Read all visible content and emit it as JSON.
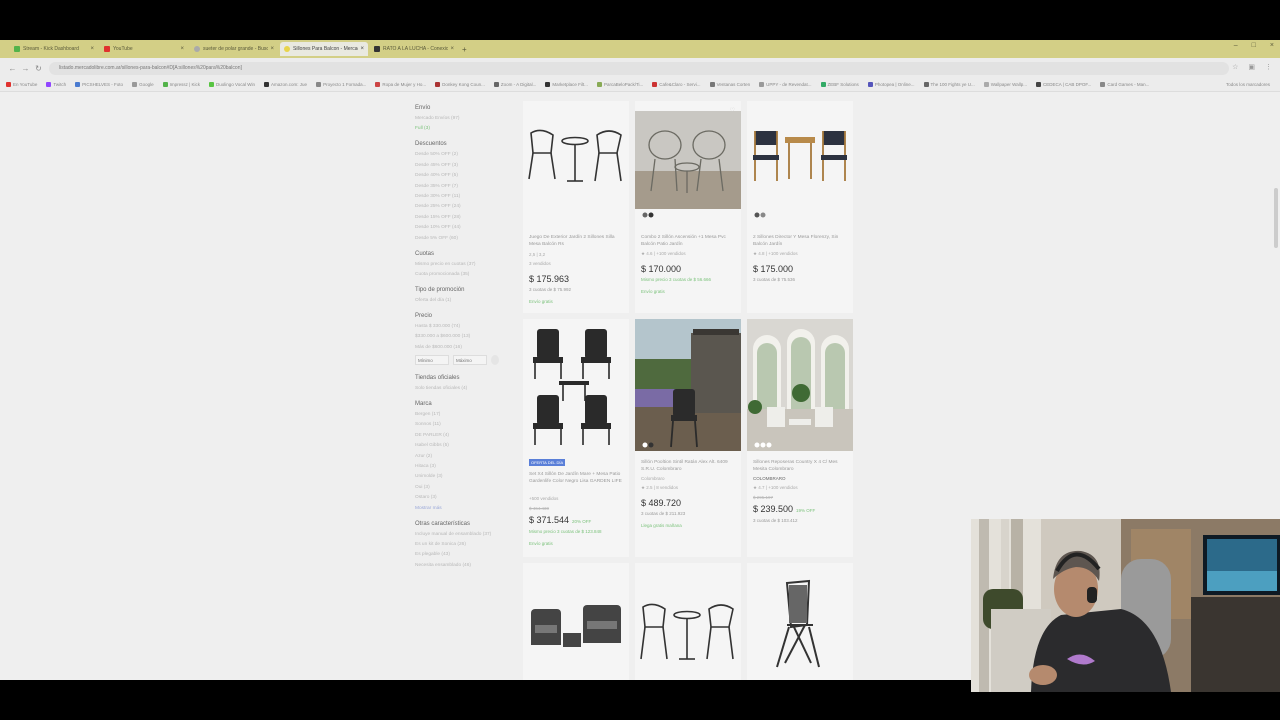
{
  "tabs": [
    {
      "title": "Stream - Kick Dashboard",
      "color": "#53b34a"
    },
    {
      "title": "YouTube",
      "color": "#e0322e"
    },
    {
      "title": "sueter de polar grande - Busc",
      "color": "#aaa"
    },
    {
      "title": "Sillones Para Balcon - Mercad",
      "color": "#aaa"
    },
    {
      "title": "RATO A LA LUCHA - Conexio",
      "color": "#333"
    }
  ],
  "url": "listado.mercadolibre.com.ar/sillones-para-balcon#D[A:sillones%20para%20balcon]",
  "bookmarks": [
    "En YouTube",
    "Twitch",
    "PICSHELVES - Foto",
    "Google",
    "Impressz | Kick",
    "Duolingo Vocal Win",
    "Amazon.com: Jue",
    "Proyecto 1 Fornada...",
    "Ropa de Mujer y Ho...",
    "Donkey Kong Coun...",
    "Zoom - A Digital...",
    "Marketplace Filt...",
    "ParcaBeloPack/Ti...",
    "Cafe&Claro - Servi...",
    "Ventanas Corten",
    "UPPY - de Revendat...",
    "ZEBF Solutions",
    "Photopea | Online...",
    "The 100 Fights ye U...",
    "Wallpaper Wallp...",
    "CEDECA | CAB DPOF...",
    "Card Games - Man..."
  ],
  "bookmarks_right": "Todos los marcadores",
  "sidebar": {
    "envio": {
      "title": "Envío",
      "items": [
        "Mercado Envíos (97)",
        "Full (3)"
      ]
    },
    "descuentos": {
      "title": "Descuentos",
      "items": [
        "Desde 50% OFF (2)",
        "Desde 45% OFF (3)",
        "Desde 40% OFF (5)",
        "Desde 35% OFF (7)",
        "Desde 30% OFF (11)",
        "Desde 25% OFF (24)",
        "Desde 15% OFF (28)",
        "Desde 10% OFF (44)",
        "Desde 5% OFF (60)"
      ]
    },
    "cuotas": {
      "title": "Cuotas",
      "items": [
        "Mismo precio en cuotas (37)",
        "Cuota promocionada (35)"
      ]
    },
    "promocion": {
      "title": "Tipo de promoción",
      "items": [
        "Oferta del día (1)"
      ]
    },
    "precio": {
      "title": "Precio",
      "items": [
        "Hasta $ 330.000 (74)",
        "$330.000 a $600.000 (13)",
        "Más de $600.000 (16)"
      ],
      "min": "Mínimo",
      "max": "Máximo"
    },
    "tiendas": {
      "title": "Tiendas oficiales",
      "items": [
        "Solo tiendas oficiales (4)"
      ]
    },
    "marca": {
      "title": "Marca",
      "items": [
        "Bergen (17)",
        "Sonnos (11)",
        "DE PARLER (4)",
        "Isabel Gibbs (5)",
        "Azur (2)",
        "Hitaca (3)",
        "Unimolde (3)",
        "Oui (3)",
        "Ostaro (3)"
      ],
      "more": "Mostrar más"
    },
    "otras": {
      "title": "Otras características",
      "items": [
        "Incluye manual de ensamblado (37)",
        "Es un kit de Sonica (26)",
        "Es plegable (43)",
        "Necesita ensamblado (46)"
      ]
    }
  },
  "products": [
    {
      "title": "Juego De Exterior Jardín 2 Sillones Silla Mesa Balcón Rs",
      "rating": "2,5 | 3,2",
      "sold": "3 vendidos",
      "price": "$ 175.963",
      "install": "3 cuotas de $ 75.992",
      "ship": "Envío gratis"
    },
    {
      "title": "Combo 2 Sillón Ascensión +1 Mesa Pvc Balcón Patio Jardín",
      "rating": "★ 4.6 | +100 vendidos",
      "price": "$ 170.000",
      "install": "Mismo precio 3 cuotas de $ 56.666",
      "ship": "Envío gratis"
    },
    {
      "title": "2 Sillones Director Y Mesa Florenzy, Sin Balcón Jardín",
      "rating": "★ 4.8 | +100 vendidos",
      "price": "$ 175.000",
      "install": "3 cuotas de $ 75.536"
    },
    {
      "badge": "OFERTA DEL DÍA",
      "title": "Set X4 Sillón De Jardín Mare + Mesa Patio Gardenlife Color Negro Lisa GARDEN LIFE",
      "sold": "+500 vendidos",
      "oldprice": "$ 464.430",
      "price": "$ 371.544",
      "off": "20% OFF",
      "install": "Mismo precio 3 cuotas de $ 123.848",
      "ship": "Envío gratis"
    },
    {
      "title": "Sillón Pooltion Sintil Ratán Alex Alt. 6409 S.R.U. Colombraro",
      "brand": "Colombraro",
      "rating": "★ 2.5 | 8 vendidos",
      "price": "$ 489.720",
      "install": "3 cuotas de $ 211.923",
      "ship": "Llega gratis mañana"
    },
    {
      "title": "Sillones Reposeras Country X 4 C/ Mes Mesita Colombraro",
      "brand": "COLOMBRARO",
      "rating": "★ 4.7 | +100 vendidos",
      "oldprice": "$ 295.197",
      "price": "$ 239.500",
      "off": "19% OFF",
      "install": "3 cuotas de $ 103.412"
    }
  ]
}
